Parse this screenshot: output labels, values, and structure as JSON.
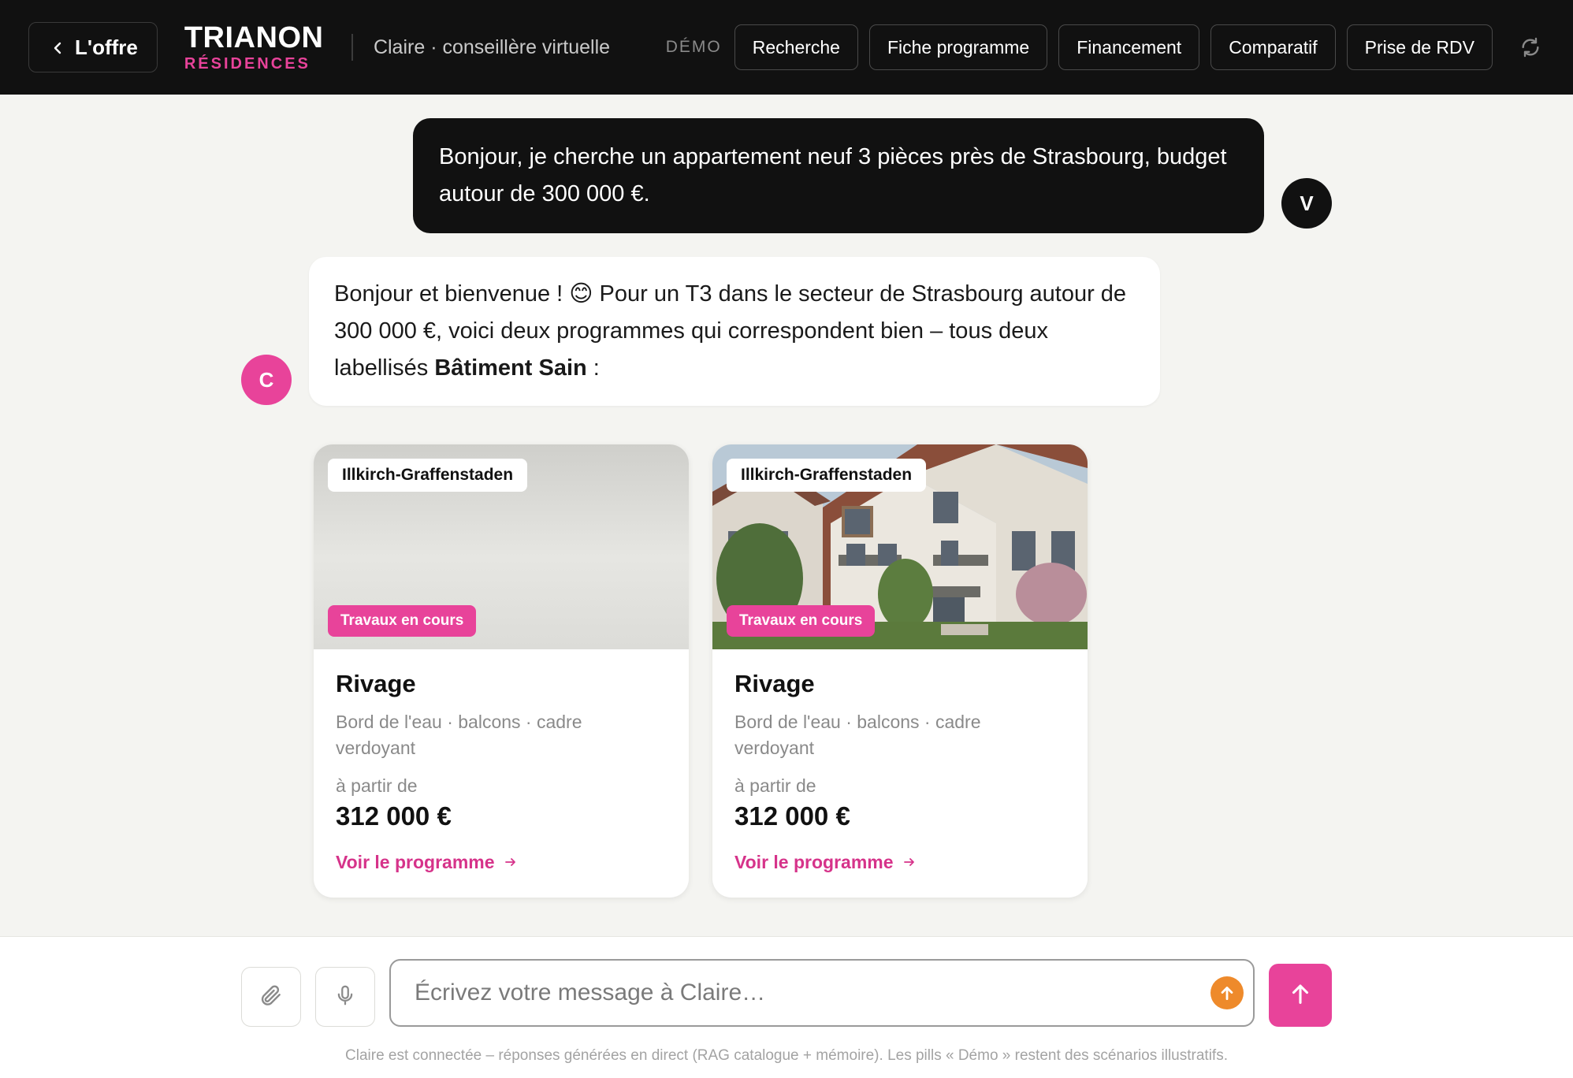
{
  "header": {
    "back_label": "L'offre",
    "brand_main": "TRIANON",
    "brand_sub": "RÉSIDENCES",
    "agent_title": "Claire · conseillère virtuelle",
    "demo_label": "DÉMO",
    "pills": [
      "Recherche",
      "Fiche programme",
      "Financement",
      "Comparatif",
      "Prise de RDV"
    ]
  },
  "chat": {
    "user_message": "Bonjour, je cherche un appartement neuf 3 pièces près de Strasbourg, budget autour de 300 000 €.",
    "user_avatar": "V",
    "bot_avatar": "C",
    "bot_message_part1": "Bonjour et bienvenue ! 😊 Pour un T3 dans le secteur de Strasbourg autour de 300 000 €, voici deux programmes qui correspondent bien – tous deux labellisés ",
    "bot_message_bold": "Bâtiment Sain",
    "bot_message_part2": " :"
  },
  "cards": [
    {
      "location": "Illkirch-Graffenstaden",
      "status": "Travaux en cours",
      "title": "Rivage",
      "description": "Bord de l'eau · balcons · cadre verdoyant",
      "price_from_label": "à partir de",
      "price": "312 000 €",
      "link_label": "Voir le programme",
      "image": "none"
    },
    {
      "location": "Illkirch-Graffenstaden",
      "status": "Travaux en cours",
      "title": "Rivage",
      "description": "Bord de l'eau · balcons · cadre verdoyant",
      "price_from_label": "à partir de",
      "price": "312 000 €",
      "link_label": "Voir le programme",
      "image": "residential-building-photo"
    }
  ],
  "composer": {
    "placeholder": "Écrivez votre message à Claire…",
    "footnote": "Claire est connectée – réponses générées en direct (RAG catalogue + mémoire). Les pills « Démo » restent des scénarios illustratifs."
  },
  "colors": {
    "brand_pink": "#e8439a",
    "header_bg": "#111111",
    "page_bg": "#f4f4f1",
    "accent_orange": "#ee8a2b"
  },
  "icons": [
    "chevron-left-icon",
    "refresh-icon",
    "paperclip-icon",
    "microphone-icon",
    "arrow-up-icon",
    "arrow-right-icon"
  ]
}
